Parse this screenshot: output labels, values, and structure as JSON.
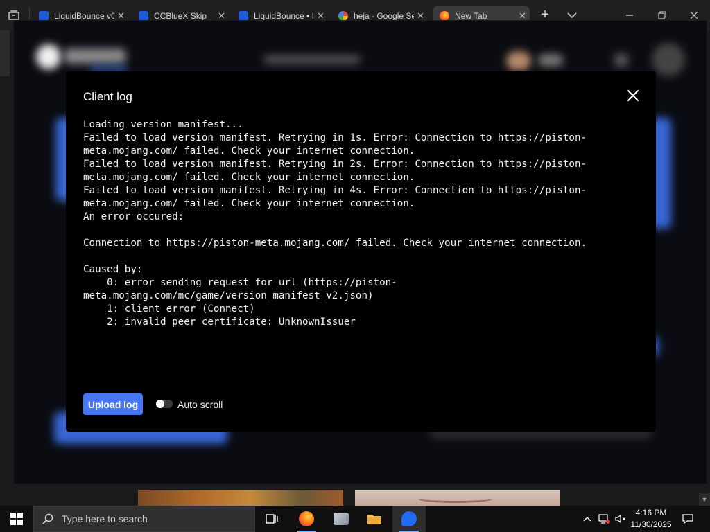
{
  "browser": {
    "tabs": [
      {
        "title": "LiquidBounce v0",
        "icon": "liquidbounce-icon",
        "color": "#1f5bd6"
      },
      {
        "title": "CCBlueX Skip",
        "icon": "liquidbounce-icon",
        "color": "#1f5bd6"
      },
      {
        "title": "LiquidBounce • I",
        "icon": "liquidbounce-icon",
        "color": "#1f5bd6"
      },
      {
        "title": "heja - Google Se",
        "icon": "google-icon",
        "color": "#4285f4"
      },
      {
        "title": "New Tab",
        "icon": "firefox-icon",
        "color": "#ff6a1a",
        "active": true
      }
    ]
  },
  "modal": {
    "title": "Client log",
    "log_text": "Loading version manifest...\nFailed to load version manifest. Retrying in 1s. Error: Connection to https://piston-\nmeta.mojang.com/ failed. Check your internet connection.\nFailed to load version manifest. Retrying in 2s. Error: Connection to https://piston-\nmeta.mojang.com/ failed. Check your internet connection.\nFailed to load version manifest. Retrying in 4s. Error: Connection to https://piston-\nmeta.mojang.com/ failed. Check your internet connection.\nAn error occured:\n\nConnection to https://piston-meta.mojang.com/ failed. Check your internet connection.\n\nCaused by:\n    0: error sending request for url (https://piston-\nmeta.mojang.com/mc/game/version_manifest_v2.json)\n    1: client error (Connect)\n    2: invalid peer certificate: UnknownIssuer",
    "upload_label": "Upload log",
    "auto_scroll_label": "Auto scroll",
    "auto_scroll_enabled": false,
    "accent_color": "#4677f5"
  },
  "taskbar": {
    "search_placeholder": "Type here to search",
    "time": "4:16 PM",
    "date": "11/30/2025",
    "pinned": [
      "task-view-icon",
      "firefox-icon",
      "app-icon",
      "file-explorer-icon",
      "liquidlauncher-icon"
    ]
  }
}
